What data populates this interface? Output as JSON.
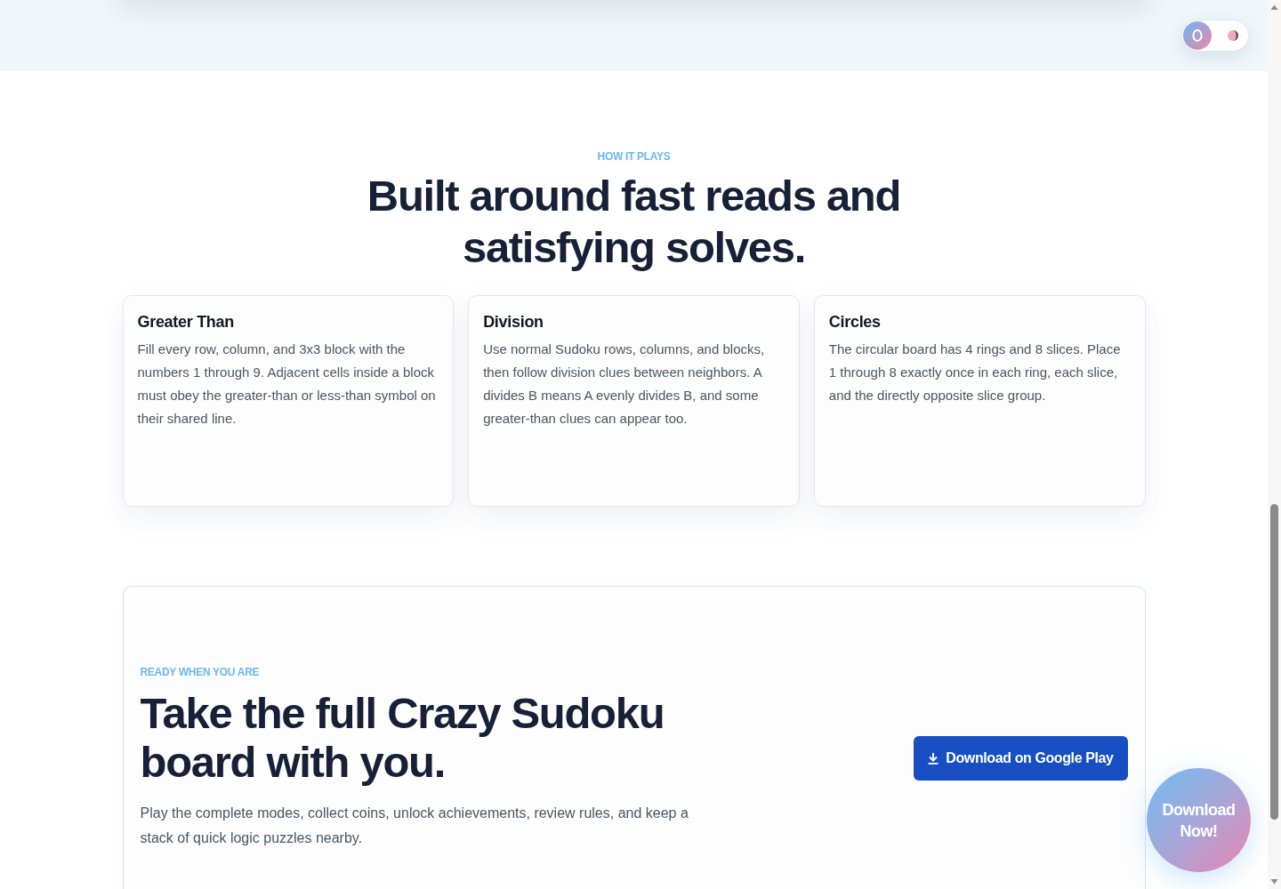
{
  "theme_toggle": {
    "dark_mode": false
  },
  "how_it_plays": {
    "eyebrow": "HOW IT PLAYS",
    "title": "Built around fast reads and satisfying solves.",
    "cards": [
      {
        "title": "Greater Than",
        "text": "Fill every row, column, and 3x3 block with the numbers 1 through 9. Adjacent cells inside a block must obey the greater-than or less-than symbol on their shared line."
      },
      {
        "title": "Division",
        "text": "Use normal Sudoku rows, columns, and blocks, then follow division clues between neighbors. A divides B means A evenly divides B, and some greater-than clues can appear too."
      },
      {
        "title": "Circles",
        "text": "The circular board has 4 rings and 8 slices. Place 1 through 8 exactly once in each ring, each slice, and the directly opposite slice group."
      }
    ]
  },
  "cta": {
    "eyebrow": "READY WHEN YOU ARE",
    "title": "Take the full Crazy Sudoku board with you.",
    "text": "Play the complete modes, collect coins, unlock achievements, review rules, and keep a stack of quick logic puzzles nearby.",
    "button": "Download on Google Play"
  },
  "floating_button": "Download Now!"
}
